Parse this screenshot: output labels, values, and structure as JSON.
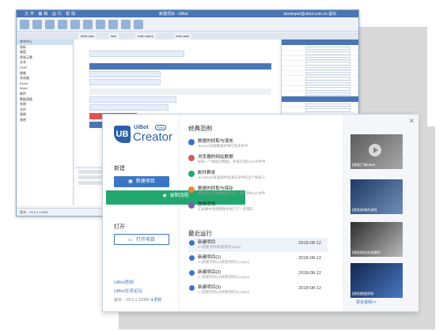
{
  "welcome": {
    "logo": {
      "mark": "UB",
      "name_top": "UiBot",
      "badge": "Beta",
      "name_main": "Creator"
    },
    "new_section": "新建",
    "new_project_btn": "新建项目",
    "record_btn": "录制流程",
    "open_section": "打开",
    "open_project_btn": "打开项目",
    "links": [
      "UiBot官网",
      "UiBot交流论坛"
    ],
    "version_label": "版本：V0.0.1.19380",
    "update_label": "更新",
    "examples_title": "经典范例",
    "examples": [
      {
        "title": "数据的抓取与填充",
        "desc": "从Excel读取数据并填写到表单中",
        "icon": "blue"
      },
      {
        "title": "浏览器的网站数据",
        "desc": "抓取一个网站的数据，并保存到Excel文件中",
        "icon": "pink"
      },
      {
        "title": "邮件群发",
        "desc": "从Outlook发送邮件给通讯录中的多个联系人",
        "icon": "green"
      },
      {
        "title": "数据的抓取与保存",
        "desc": "将网页上的数据抓取下来，保存到Excel文件",
        "icon": "orange"
      },
      {
        "title": "图像查找",
        "desc": "在屏幕中查找图像并进行下一步操作",
        "icon": "purple"
      }
    ],
    "recent_title": "最近运行",
    "recent": [
      {
        "name": "新建项目",
        "path": "C:\\新建项目\\新建项目.uiproj",
        "date": "2018-08-12",
        "highlight": true
      },
      {
        "name": "新建项目(1)",
        "path": "C:\\新建项目(1)\\新建项目(1).uiproj",
        "date": "2018-08-12",
        "highlight": false
      },
      {
        "name": "新建项目(2)",
        "path": "C:\\新建项目(2)\\新建项目(2).uiproj",
        "date": "2018-08-12",
        "highlight": false
      },
      {
        "name": "新建项目(3)",
        "path": "C:\\新建项目(3)\\新建项目(3).uiproj",
        "date": "2018-08-12",
        "highlight": false
      }
    ],
    "videos": [
      "[视频]了解UiBot",
      "[视频]录制的流程",
      "[视频]如何实现循环",
      "[视频]数据抓取"
    ],
    "more_videos": "更多视频>>"
  },
  "ide": {
    "title": "新建项目 - UiBot",
    "user": "developer@uibot.com.cn 退出",
    "menu": "文件 编辑 运行 帮助",
    "tabs": [
      "Main.task",
      "task",
      "main.uiproj",
      "main.task"
    ],
    "left_header": "命令中心",
    "left_items": [
      "鼠标",
      "键盘",
      "界面元素",
      "文本",
      "OCR",
      "图像",
      "浏览器",
      "Excel",
      "Word",
      "邮件",
      "数据表格",
      "系统",
      "文件",
      "网络",
      "其他"
    ],
    "output_title": "输出",
    "status": "版本：V0.0.1.19380"
  }
}
